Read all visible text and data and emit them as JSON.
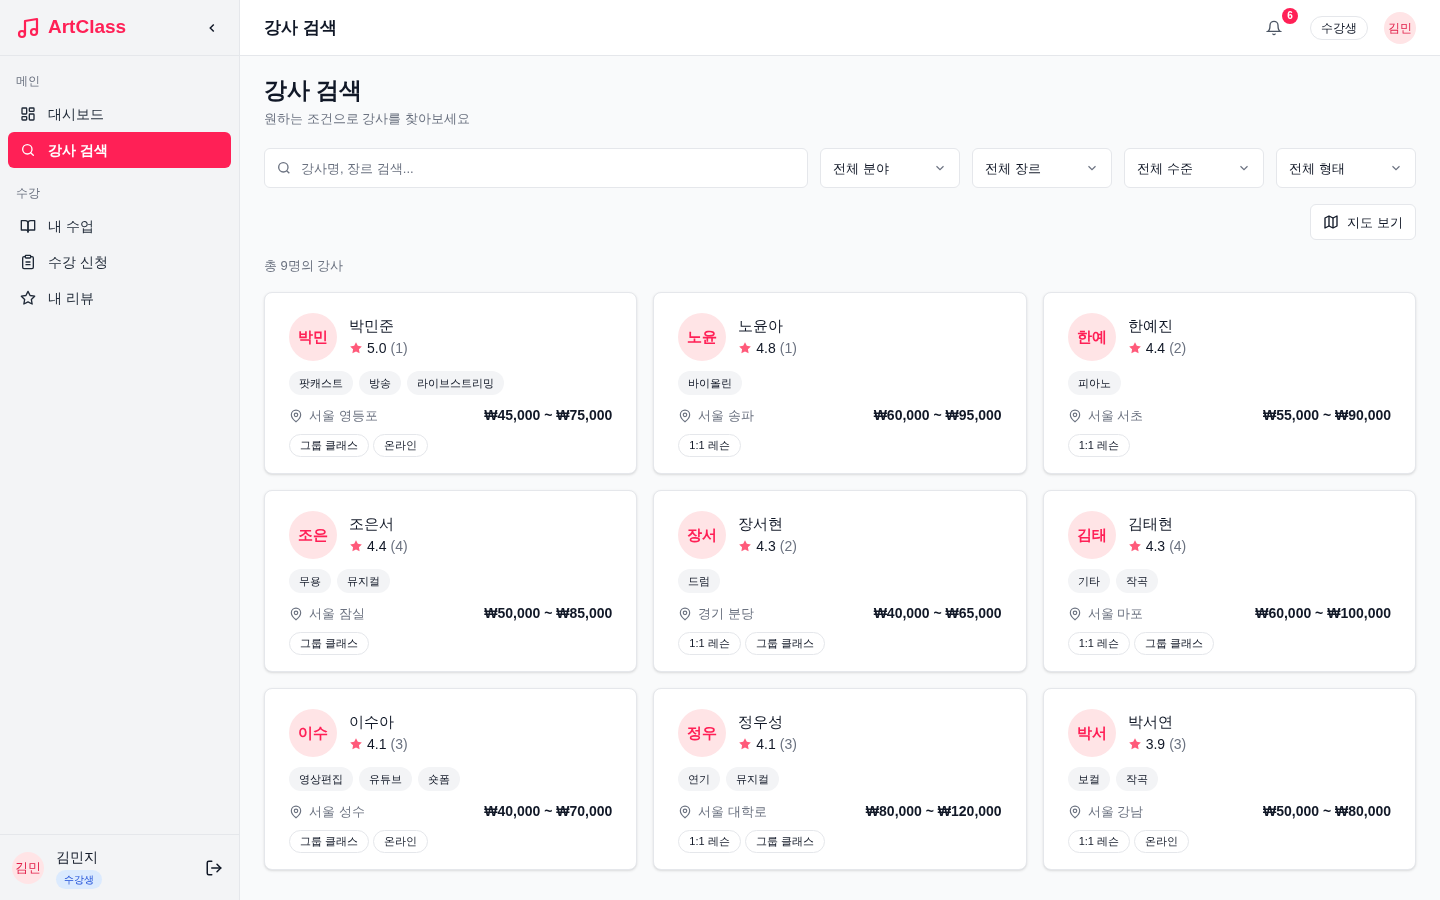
{
  "sidebar": {
    "brand": "ArtClass",
    "sections": [
      {
        "label": "메인",
        "items": [
          {
            "label": "대시보드",
            "kind": "grid",
            "selected": false
          },
          {
            "label": "강사 검색",
            "kind": "search",
            "selected": true
          }
        ]
      },
      {
        "label": "수강",
        "items": [
          {
            "label": "내 수업",
            "kind": "book",
            "selected": false
          },
          {
            "label": "수강 신청",
            "kind": "clipboard",
            "selected": false
          },
          {
            "label": "내 리뷰",
            "kind": "star",
            "selected": false
          }
        ]
      }
    ],
    "user": {
      "avatar": "김민",
      "name": "김민지",
      "role": "수강생"
    }
  },
  "header": {
    "title": "강사 검색",
    "notifications": "6",
    "role": "수강생",
    "avatar": "김민"
  },
  "page": {
    "title": "강사 검색",
    "subtitle": "원하는 조건으로 강사를 찾아보세요"
  },
  "search": {
    "placeholder": "강사명, 장르 검색..."
  },
  "filters": [
    "전체 분야",
    "전체 장르",
    "전체 수준",
    "전체 형태"
  ],
  "map_button": "지도 보기",
  "count": "총 9명의 강사",
  "instructors": [
    {
      "avatar": "박민",
      "name": "박민준",
      "rating": "5.0",
      "reviews": "(1)",
      "genres": [
        "팟캐스트",
        "방송",
        "라이브스트리밍"
      ],
      "location": "서울 영등포",
      "price": "₩45,000 ~ ₩75,000",
      "formats": [
        "그룹 클래스",
        "온라인"
      ]
    },
    {
      "avatar": "노윤",
      "name": "노윤아",
      "rating": "4.8",
      "reviews": "(1)",
      "genres": [
        "바이올린"
      ],
      "location": "서울 송파",
      "price": "₩60,000 ~ ₩95,000",
      "formats": [
        "1:1 레슨"
      ]
    },
    {
      "avatar": "한예",
      "name": "한예진",
      "rating": "4.4",
      "reviews": "(2)",
      "genres": [
        "피아노"
      ],
      "location": "서울 서초",
      "price": "₩55,000 ~ ₩90,000",
      "formats": [
        "1:1 레슨"
      ]
    },
    {
      "avatar": "조은",
      "name": "조은서",
      "rating": "4.4",
      "reviews": "(4)",
      "genres": [
        "무용",
        "뮤지컬"
      ],
      "location": "서울 잠실",
      "price": "₩50,000 ~ ₩85,000",
      "formats": [
        "그룹 클래스"
      ]
    },
    {
      "avatar": "장서",
      "name": "장서현",
      "rating": "4.3",
      "reviews": "(2)",
      "genres": [
        "드럼"
      ],
      "location": "경기 분당",
      "price": "₩40,000 ~ ₩65,000",
      "formats": [
        "1:1 레슨",
        "그룹 클래스"
      ]
    },
    {
      "avatar": "김태",
      "name": "김태현",
      "rating": "4.3",
      "reviews": "(4)",
      "genres": [
        "기타",
        "작곡"
      ],
      "location": "서울 마포",
      "price": "₩60,000 ~ ₩100,000",
      "formats": [
        "1:1 레슨",
        "그룹 클래스"
      ]
    },
    {
      "avatar": "이수",
      "name": "이수아",
      "rating": "4.1",
      "reviews": "(3)",
      "genres": [
        "영상편집",
        "유튜브",
        "숏폼"
      ],
      "location": "서울 성수",
      "price": "₩40,000 ~ ₩70,000",
      "formats": [
        "그룹 클래스",
        "온라인"
      ]
    },
    {
      "avatar": "정우",
      "name": "정우성",
      "rating": "4.1",
      "reviews": "(3)",
      "genres": [
        "연기",
        "뮤지컬"
      ],
      "location": "서울 대학로",
      "price": "₩80,000 ~ ₩120,000",
      "formats": [
        "1:1 레슨",
        "그룹 클래스"
      ]
    },
    {
      "avatar": "박서",
      "name": "박서연",
      "rating": "3.9",
      "reviews": "(3)",
      "genres": [
        "보컬",
        "작곡"
      ],
      "location": "서울 강남",
      "price": "₩50,000 ~ ₩80,000",
      "formats": [
        "1:1 레슨",
        "온라인"
      ]
    }
  ]
}
